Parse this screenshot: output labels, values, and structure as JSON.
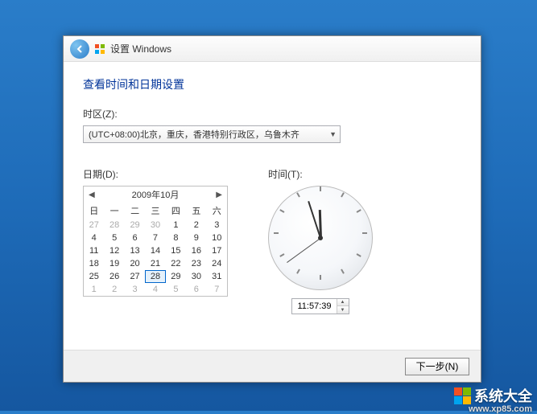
{
  "window": {
    "title": "设置 Windows"
  },
  "heading": "查看时间和日期设置",
  "timezone": {
    "label": "时区(Z):",
    "value": "(UTC+08:00)北京，重庆，香港特别行政区，乌鲁木齐"
  },
  "date": {
    "label": "日期(D):"
  },
  "time": {
    "label": "时间(T):",
    "value": "11:57:39"
  },
  "calendar": {
    "title": "2009年10月",
    "dow": [
      "日",
      "一",
      "二",
      "三",
      "四",
      "五",
      "六"
    ],
    "weeks": [
      [
        {
          "d": 27,
          "o": true
        },
        {
          "d": 28,
          "o": true
        },
        {
          "d": 29,
          "o": true
        },
        {
          "d": 30,
          "o": true
        },
        {
          "d": 1
        },
        {
          "d": 2
        },
        {
          "d": 3
        }
      ],
      [
        {
          "d": 4
        },
        {
          "d": 5
        },
        {
          "d": 6
        },
        {
          "d": 7
        },
        {
          "d": 8
        },
        {
          "d": 9
        },
        {
          "d": 10
        }
      ],
      [
        {
          "d": 11
        },
        {
          "d": 12
        },
        {
          "d": 13
        },
        {
          "d": 14
        },
        {
          "d": 15
        },
        {
          "d": 16
        },
        {
          "d": 17
        }
      ],
      [
        {
          "d": 18
        },
        {
          "d": 19
        },
        {
          "d": 20
        },
        {
          "d": 21
        },
        {
          "d": 22
        },
        {
          "d": 23
        },
        {
          "d": 24
        }
      ],
      [
        {
          "d": 25
        },
        {
          "d": 26
        },
        {
          "d": 27
        },
        {
          "d": 28,
          "sel": true
        },
        {
          "d": 29
        },
        {
          "d": 30
        },
        {
          "d": 31
        }
      ],
      [
        {
          "d": 1,
          "o": true
        },
        {
          "d": 2,
          "o": true
        },
        {
          "d": 3,
          "o": true
        },
        {
          "d": 4,
          "o": true
        },
        {
          "d": 5,
          "o": true
        },
        {
          "d": 6,
          "o": true
        },
        {
          "d": 7,
          "o": true
        }
      ]
    ]
  },
  "footer": {
    "next": "下一步(N)"
  },
  "watermark": {
    "text": "系统大全",
    "url": "www.xp85.com"
  },
  "hands": {
    "hour_deg": 358,
    "minute_deg": 342,
    "second_deg": 234
  }
}
